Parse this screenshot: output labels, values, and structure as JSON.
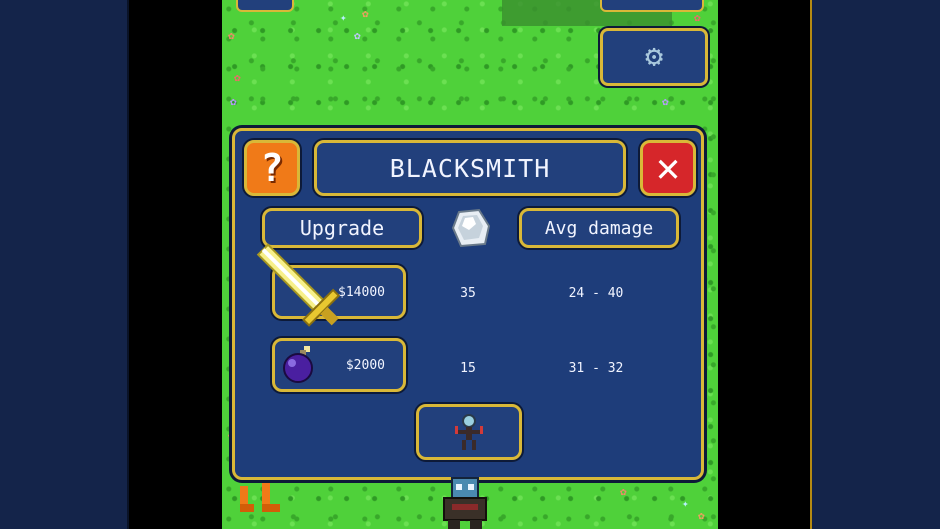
{
  "dialog": {
    "title": "BLACKSMITH",
    "help_symbol": "?",
    "close_symbol": "✕"
  },
  "columns": {
    "upgrade": "Upgrade",
    "avg_damage": "Avg damage"
  },
  "items": [
    {
      "icon": "sword-icon",
      "price": "$14000",
      "stat": "35",
      "avg_damage": "24 - 40"
    },
    {
      "icon": "bomb-icon",
      "price": "$2000",
      "stat": "15",
      "avg_damage": "31 - 32"
    }
  ],
  "icons": {
    "settings": "gear-icon",
    "stat_column": "stone-icon",
    "hero_button": "hero-icon"
  },
  "colors": {
    "panel": "#1e3d7a",
    "border": "#d9b838",
    "grass": "#4fd13a",
    "help_button": "#f07a18",
    "close_button": "#d6262a"
  }
}
